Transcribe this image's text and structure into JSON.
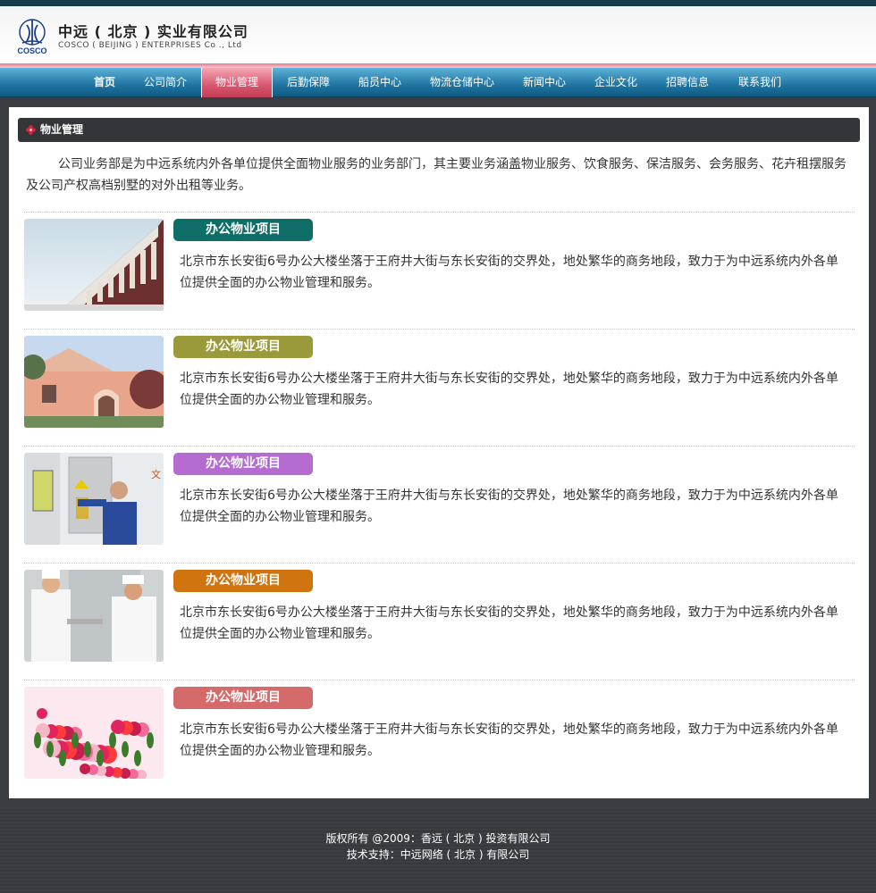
{
  "header": {
    "logo_cn": "中远 ( 北京 ) 实业有限公司",
    "logo_en": "COSCO ( BEIJING ) ENTERPRISES Co ., Ltd",
    "logo_mark_text": "COSCO"
  },
  "nav": {
    "items": [
      {
        "label": "首页"
      },
      {
        "label": "公司简介"
      },
      {
        "label": "物业管理",
        "active": true
      },
      {
        "label": "后勤保障"
      },
      {
        "label": "船员中心"
      },
      {
        "label": "物流仓储中心"
      },
      {
        "label": "新闻中心"
      },
      {
        "label": "企业文化"
      },
      {
        "label": "招聘信息"
      },
      {
        "label": "联系我们"
      }
    ]
  },
  "section": {
    "title": "物业管理",
    "intro": "公司业务部是为中远系统内外各单位提供全面物业服务的业务部门，其主要业务涵盖物业服务、饮食服务、保洁服务、会务服务、花卉租摆服务及公司产权高档别墅的对外出租等业务。"
  },
  "items": [
    {
      "title": "办公物业项目",
      "color": "#0e6e67",
      "desc": "北京市东长安街6号办公大楼坐落于王府井大街与东长安街的交界处，地处繁华的商务地段，致力于为中远系统内外各单位提供全面的办公物业管理和服务。"
    },
    {
      "title": "办公物业项目",
      "color": "#9a9a3a",
      "desc": "北京市东长安街6号办公大楼坐落于王府井大街与东长安街的交界处，地处繁华的商务地段，致力于为中远系统内外各单位提供全面的办公物业管理和服务。"
    },
    {
      "title": "办公物业项目",
      "color": "#b46cd0",
      "desc": "北京市东长安街6号办公大楼坐落于王府井大街与东长安街的交界处，地处繁华的商务地段，致力于为中远系统内外各单位提供全面的办公物业管理和服务。"
    },
    {
      "title": "办公物业项目",
      "color": "#d07410",
      "desc": "北京市东长安街6号办公大楼坐落于王府井大街与东长安街的交界处，地处繁华的商务地段，致力于为中远系统内外各单位提供全面的办公物业管理和服务。"
    },
    {
      "title": "办公物业项目",
      "color": "#d46a6a",
      "desc": "北京市东长安街6号办公大楼坐落于王府井大街与东长安街的交界处，地处繁华的商务地段，致力于为中远系统内外各单位提供全面的办公物业管理和服务。"
    }
  ],
  "footer": {
    "copyright": "版权所有 @2009：香远 ( 北京 ) 投资有限公司",
    "support": "技术支持：中远网络 ( 北京 ) 有限公司"
  }
}
